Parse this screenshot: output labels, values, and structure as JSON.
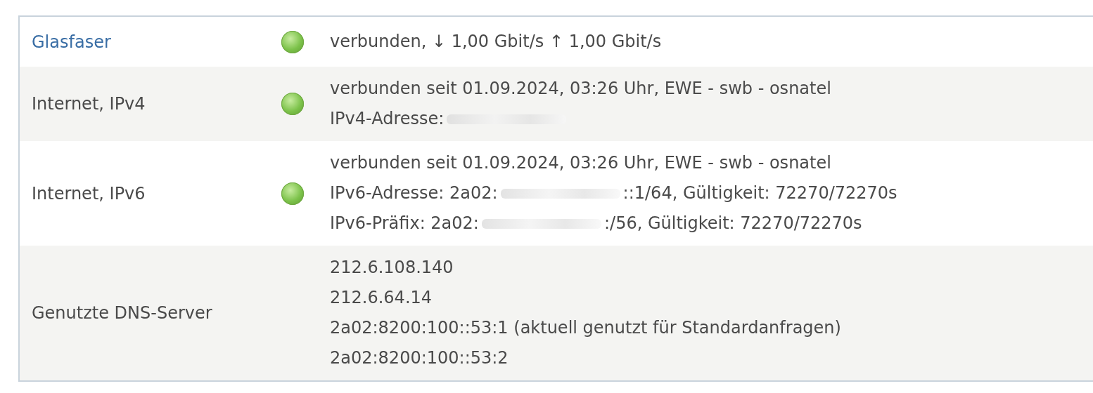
{
  "rows": [
    {
      "label": "Glasfaser",
      "link": true,
      "indicator": true,
      "lines": [
        {
          "text": "verbunden, ↓ 1,00 Gbit/s ↑ 1,00 Gbit/s",
          "redacted": false
        }
      ]
    },
    {
      "label": "Internet, IPv4",
      "link": false,
      "indicator": true,
      "lines": [
        {
          "text": "verbunden seit 01.09.2024, 03:26 Uhr, EWE - swb - osnatel",
          "redacted": false
        },
        {
          "text": "IPv4-Adresse:",
          "redacted": true
        }
      ]
    },
    {
      "label": "Internet, IPv6",
      "link": false,
      "indicator": true,
      "lines": [
        {
          "text": "verbunden seit 01.09.2024, 03:26 Uhr, EWE - swb - osnatel",
          "redacted": false
        },
        {
          "text": "IPv6-Adresse: 2a02:",
          "redacted": true,
          "after": "::1/64, Gültigkeit: 72270/72270s"
        },
        {
          "text": "IPv6-Präfix: 2a02:",
          "redacted": true,
          "after": ":/56, Gültigkeit: 72270/72270s"
        }
      ]
    },
    {
      "label": "Genutzte DNS-Server",
      "link": false,
      "indicator": false,
      "lines": [
        {
          "text": "212.6.108.140",
          "redacted": false
        },
        {
          "text": "212.6.64.14",
          "redacted": false
        },
        {
          "text": "2a02:8200:100::53:1 (aktuell genutzt für Standardanfragen)",
          "redacted": false
        },
        {
          "text": "2a02:8200:100::53:2",
          "redacted": false
        }
      ]
    }
  ]
}
